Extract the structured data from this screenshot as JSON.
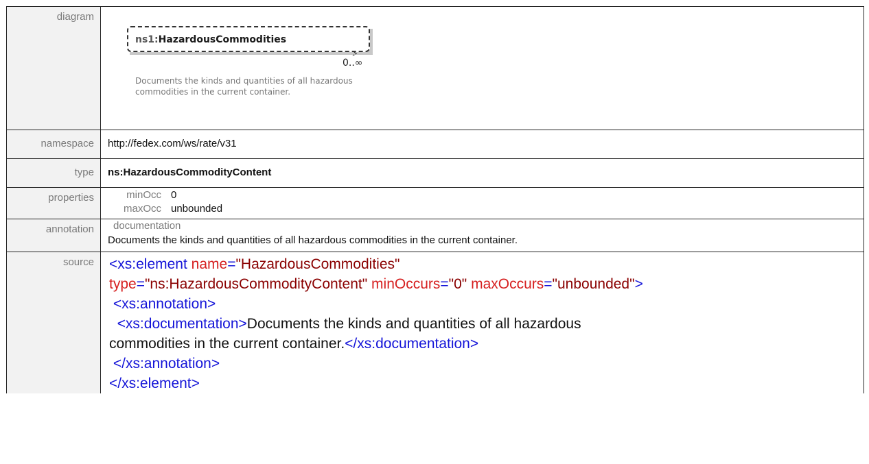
{
  "labels": {
    "diagram": "diagram",
    "namespace": "namespace",
    "type": "type",
    "properties": "properties",
    "annotation": "annotation",
    "source": "source"
  },
  "diagram": {
    "element_prefix": "ns1:",
    "element_name": "HazardousCommodities",
    "occurs": "0..∞",
    "documentation": "Documents the kinds and quantities of all hazardous commodities in the current container."
  },
  "namespace": "http://fedex.com/ws/rate/v31",
  "type": "ns:HazardousCommodityContent",
  "properties": {
    "minOcc_label": "minOcc",
    "minOcc_value": "0",
    "maxOcc_label": "maxOcc",
    "maxOcc_value": "unbounded"
  },
  "annotation": {
    "key": "documentation",
    "text": "Documents the kinds and quantities of all hazardous commodities  in the current container."
  },
  "source": {
    "line1_tag": "<xs:element",
    "line1_attr": "name",
    "line1_eq": "=",
    "line1_val": "\"HazardousCommodities\"",
    "line2_attr_type": "type",
    "line2_val_type": "\"ns:HazardousCommodityContent\"",
    "line2_attr_min": "minOccurs",
    "line2_val_min": "\"0\"",
    "line2_attr_max": "maxOccurs",
    "line2_val_max": "\"unbounded\"",
    "line2_close": ">",
    "line3": "<xs:annotation>",
    "line4_open": "<xs:documentation>",
    "line4_text": "Documents the kinds and quantities of all hazardous",
    "line5_text": "commodities in the current container.",
    "line5_close": "</xs:documentation>",
    "line6": "</xs:annotation>",
    "line7": "</xs:element>"
  }
}
